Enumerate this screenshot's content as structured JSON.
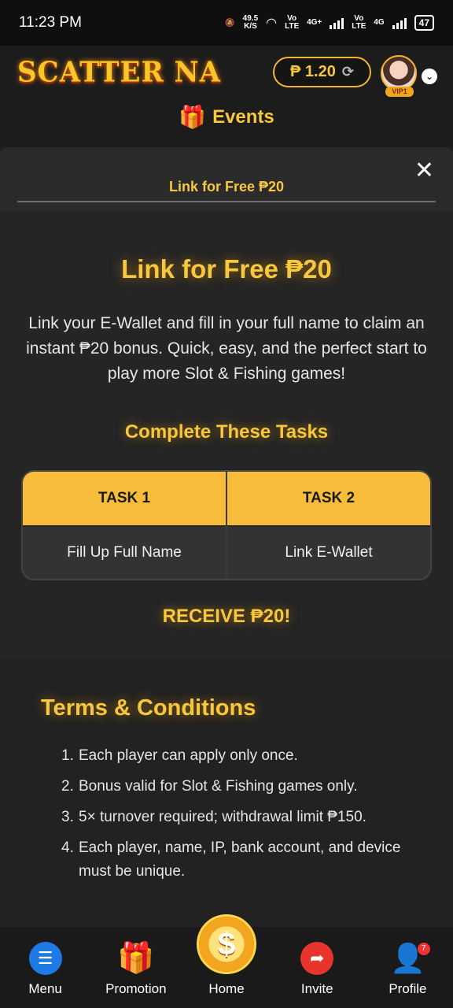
{
  "status_bar": {
    "time": "11:23 PM",
    "net_speed_value": "49.5",
    "net_speed_unit": "K/S",
    "volte1": "Vo LTE",
    "net1": "4G+",
    "volte2": "Vo LTE",
    "net2": "4G",
    "battery": "47"
  },
  "header": {
    "logo": "SCATTER NA",
    "balance": "₱ 1.20",
    "vip_label": "VIP1",
    "events_label": "Events"
  },
  "panel": {
    "tab_title": "Link for Free ₱20",
    "main_title": "Link for Free ₱20",
    "description": "Link your E-Wallet and fill in your full name to claim an instant ₱20 bonus. Quick, easy, and the perfect start to play more Slot & Fishing games!",
    "tasks_title": "Complete These Tasks",
    "tasks": [
      {
        "header": "TASK 1",
        "body": "Fill Up Full Name"
      },
      {
        "header": "TASK 2",
        "body": "Link E-Wallet"
      }
    ],
    "receive": "RECEIVE ₱20!",
    "terms_title": "Terms & Conditions",
    "terms": [
      {
        "num": "1.",
        "text": "Each player can apply only once."
      },
      {
        "num": "2.",
        "text": "Bonus valid for Slot & Fishing games only."
      },
      {
        "num": "3.",
        "text": "5× turnover required; withdrawal limit ₱150."
      },
      {
        "num": "4.",
        "text": "Each player, name, IP, bank account, and device must be unique."
      }
    ]
  },
  "bottom_nav": {
    "items": [
      {
        "label": "Menu"
      },
      {
        "label": "Promotion"
      },
      {
        "label": "Home"
      },
      {
        "label": "Invite"
      },
      {
        "label": "Profile"
      }
    ],
    "profile_badge": "7"
  }
}
